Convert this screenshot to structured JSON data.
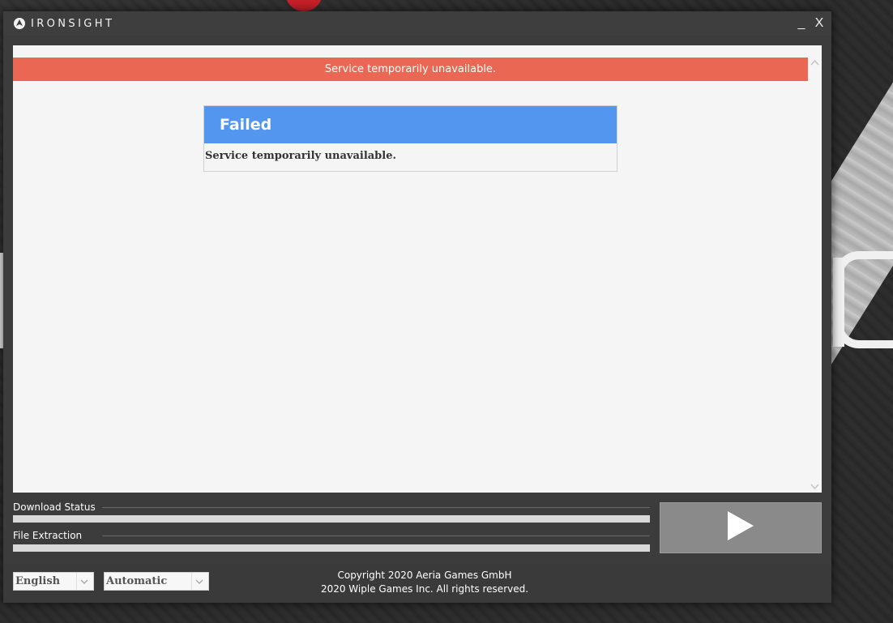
{
  "window": {
    "title": "IRONSIGHT",
    "minimize_label": "_",
    "close_label": "X"
  },
  "content": {
    "banner_text": "Service temporarily unavailable.",
    "dialog": {
      "title": "Failed",
      "message": "Service temporarily unavailable."
    }
  },
  "progress": {
    "download_label": "Download Status",
    "download_fraction": 0,
    "extraction_label": "File Extraction",
    "extraction_fraction": 0
  },
  "footer": {
    "language_selected": "English",
    "mode_selected": "Automatic",
    "copyright_line1": "Copyright 2020 Aeria Games GmbH",
    "copyright_line2": "2020 Wiple Games Inc. All rights reserved."
  },
  "icons": {
    "logo": "ironsight-logo-icon",
    "play": "play-icon",
    "scroll_up": "chevron-up-icon",
    "scroll_down": "chevron-down-icon",
    "dropdown": "chevron-down-icon"
  },
  "colors": {
    "error_banner": "#e96753",
    "dialog_header": "#5396f0",
    "window_bg": "#3c3c3c"
  }
}
